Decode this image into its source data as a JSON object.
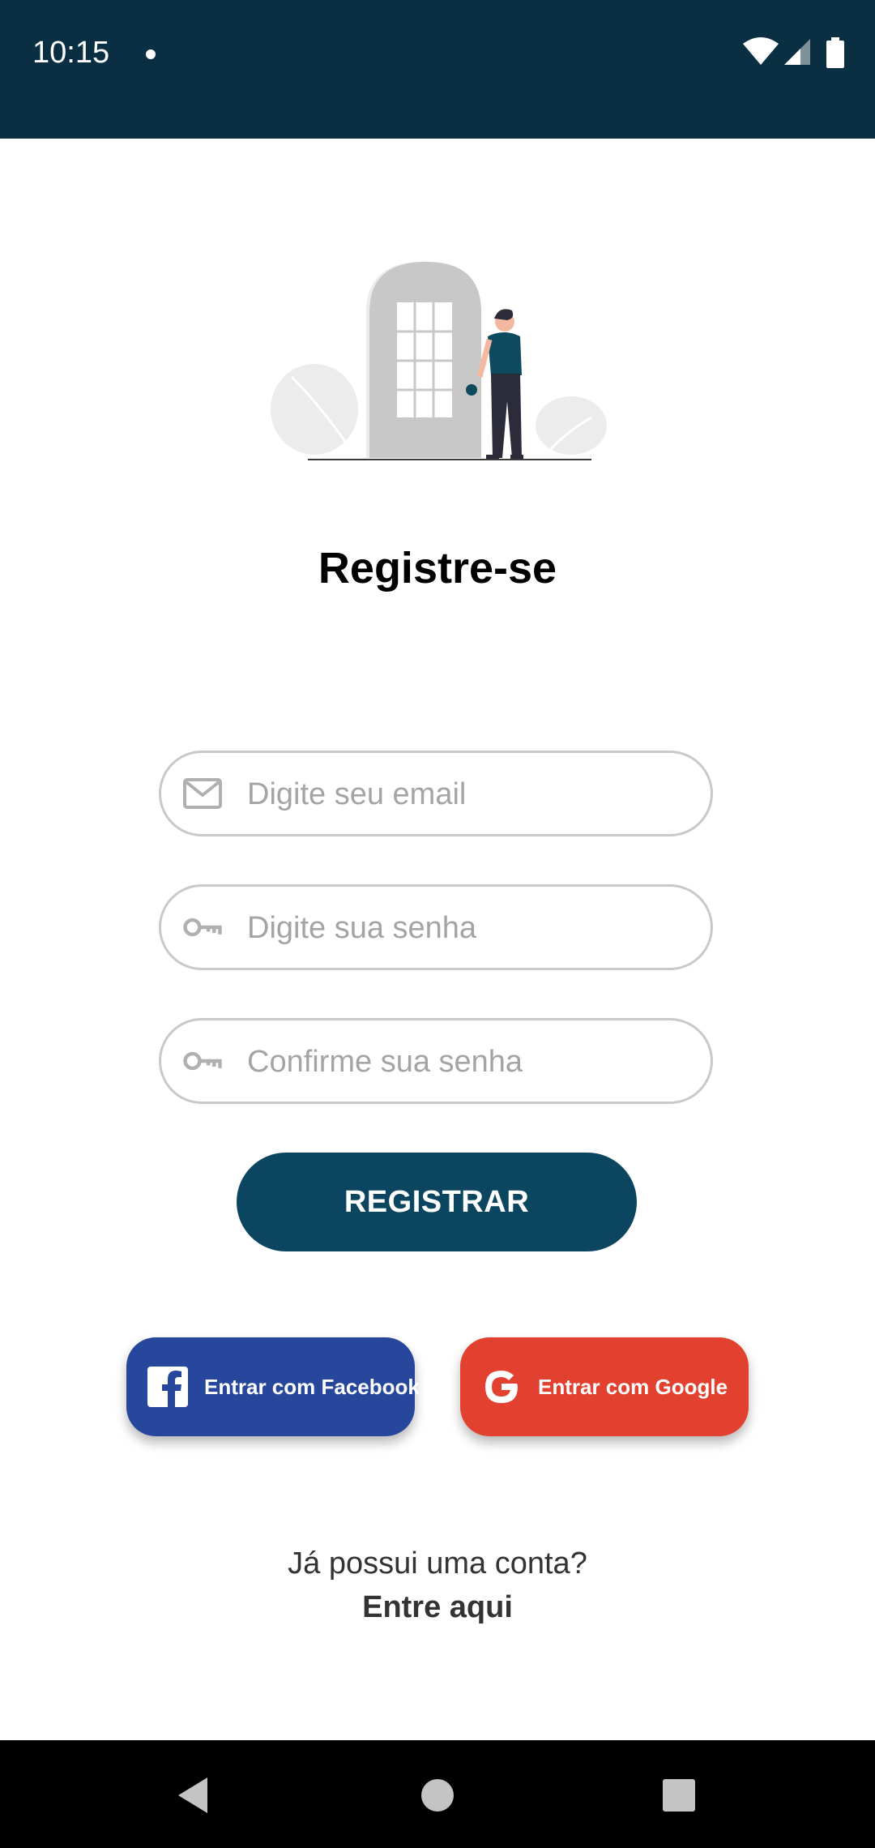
{
  "status_bar": {
    "time": "10:15",
    "icons": [
      "dot-indicator",
      "wifi-icon",
      "signal-icon",
      "battery-icon"
    ]
  },
  "register": {
    "title": "Registre-se",
    "email": {
      "placeholder": "Digite seu email",
      "value": ""
    },
    "password": {
      "placeholder": "Digite sua senha",
      "value": ""
    },
    "confirm_password": {
      "placeholder": "Confirme sua senha",
      "value": ""
    },
    "submit_label": "REGISTRAR"
  },
  "social": {
    "facebook_label": "Entrar com Facebook",
    "google_label": "Entrar com Google"
  },
  "footer": {
    "question": "Já possui uma conta?",
    "login_link": "Entre aqui"
  },
  "colors": {
    "status_bar": "#0a2f42",
    "primary": "#0b4560",
    "facebook": "#26479c",
    "google": "#e2412f",
    "field_border": "#c9c9c9"
  },
  "nav": {
    "icons": [
      "back-icon",
      "home-icon",
      "recents-icon"
    ]
  }
}
